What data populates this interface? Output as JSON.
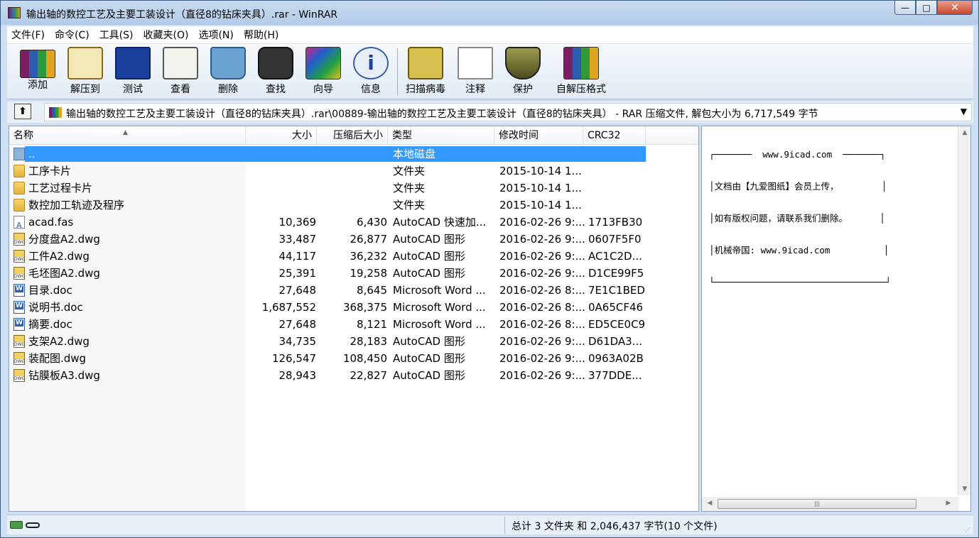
{
  "window": {
    "title": "输出轴的数控工艺及主要工装设计（直径8的钻床夹具）.rar - WinRAR",
    "controls": {
      "minimize": "—",
      "maximize": "□",
      "close": "✕"
    }
  },
  "menu": [
    "文件(F)",
    "命令(C)",
    "工具(S)",
    "收藏夹(O)",
    "选项(N)",
    "帮助(H)"
  ],
  "toolbar": [
    {
      "label": "添加",
      "icon": "add-archive-icon"
    },
    {
      "label": "解压到",
      "icon": "extract-to-icon"
    },
    {
      "label": "测试",
      "icon": "test-icon"
    },
    {
      "label": "查看",
      "icon": "view-icon"
    },
    {
      "label": "删除",
      "icon": "delete-icon"
    },
    {
      "label": "查找",
      "icon": "find-icon"
    },
    {
      "label": "向导",
      "icon": "wizard-icon"
    },
    {
      "label": "信息",
      "icon": "info-icon"
    },
    {
      "label": "扫描病毒",
      "icon": "virus-scan-icon"
    },
    {
      "label": "注释",
      "icon": "comment-icon"
    },
    {
      "label": "保护",
      "icon": "protect-icon"
    },
    {
      "label": "自解压格式",
      "icon": "sfx-icon"
    }
  ],
  "address": {
    "path": "输出轴的数控工艺及主要工装设计（直径8的钻床夹具）.rar\\00889-输出轴的数控工艺及主要工装设计（直径8的钻床夹具） - RAR 压缩文件, 解包大小为 6,717,549 字节"
  },
  "columns": {
    "name": "名称",
    "size": "大小",
    "packed": "压缩后大小",
    "type": "类型",
    "modified": "修改时间",
    "crc": "CRC32"
  },
  "files": [
    {
      "name": "..",
      "size": "",
      "packed": "",
      "type": "本地磁盘",
      "modified": "",
      "crc": "",
      "kind": "up",
      "selected": true
    },
    {
      "name": "工序卡片",
      "size": "",
      "packed": "",
      "type": "文件夹",
      "modified": "2015-10-14 1...",
      "crc": "",
      "kind": "folder"
    },
    {
      "name": "工艺过程卡片",
      "size": "",
      "packed": "",
      "type": "文件夹",
      "modified": "2015-10-14 1...",
      "crc": "",
      "kind": "folder"
    },
    {
      "name": "数控加工轨迹及程序",
      "size": "",
      "packed": "",
      "type": "文件夹",
      "modified": "2015-10-14 1...",
      "crc": "",
      "kind": "folder"
    },
    {
      "name": "acad.fas",
      "size": "10,369",
      "packed": "6,430",
      "type": "AutoCAD 快速加...",
      "modified": "2016-02-26 9:...",
      "crc": "1713FB30",
      "kind": "fas"
    },
    {
      "name": "分度盘A2.dwg",
      "size": "33,487",
      "packed": "26,877",
      "type": "AutoCAD 图形",
      "modified": "2016-02-26 9:...",
      "crc": "0607F5F0",
      "kind": "dwg"
    },
    {
      "name": "工件A2.dwg",
      "size": "44,117",
      "packed": "36,232",
      "type": "AutoCAD 图形",
      "modified": "2016-02-26 9:...",
      "crc": "AC1C2D...",
      "kind": "dwg"
    },
    {
      "name": "毛坯图A2.dwg",
      "size": "25,391",
      "packed": "19,258",
      "type": "AutoCAD 图形",
      "modified": "2016-02-26 9:...",
      "crc": "D1CE99F5",
      "kind": "dwg"
    },
    {
      "name": "目录.doc",
      "size": "27,648",
      "packed": "8,645",
      "type": "Microsoft Word ...",
      "modified": "2016-02-26 8:...",
      "crc": "7E1C1BED",
      "kind": "doc"
    },
    {
      "name": "说明书.doc",
      "size": "1,687,552",
      "packed": "368,375",
      "type": "Microsoft Word ...",
      "modified": "2016-02-26 8:...",
      "crc": "0A65CF46",
      "kind": "doc"
    },
    {
      "name": "摘要.doc",
      "size": "27,648",
      "packed": "8,121",
      "type": "Microsoft Word ...",
      "modified": "2016-02-26 8:...",
      "crc": "ED5CE0C9",
      "kind": "doc"
    },
    {
      "name": "支架A2.dwg",
      "size": "34,735",
      "packed": "28,183",
      "type": "AutoCAD 图形",
      "modified": "2016-02-26 9:...",
      "crc": "D61DA3...",
      "kind": "dwg"
    },
    {
      "name": "装配图.dwg",
      "size": "126,547",
      "packed": "108,450",
      "type": "AutoCAD 图形",
      "modified": "2016-02-26 9:...",
      "crc": "0963A02B",
      "kind": "dwg"
    },
    {
      "name": "钻膜板A3.dwg",
      "size": "28,943",
      "packed": "22,827",
      "type": "AutoCAD 图形",
      "modified": "2016-02-26 9:...",
      "crc": "377DDE...",
      "kind": "dwg"
    }
  ],
  "comment": {
    "lines": [
      "┌───────  www.9icad.com  ───────┐",
      "│文档由【九爱图纸】会员上传，        │",
      "│如有版权问题，请联系我们删除。      │",
      "│机械帝国: www.9icad.com          │",
      "└────────────────────────────────┘"
    ]
  },
  "status": {
    "summary": "总计 3 文件夹 和 2,046,437 字节(10 个文件)"
  }
}
